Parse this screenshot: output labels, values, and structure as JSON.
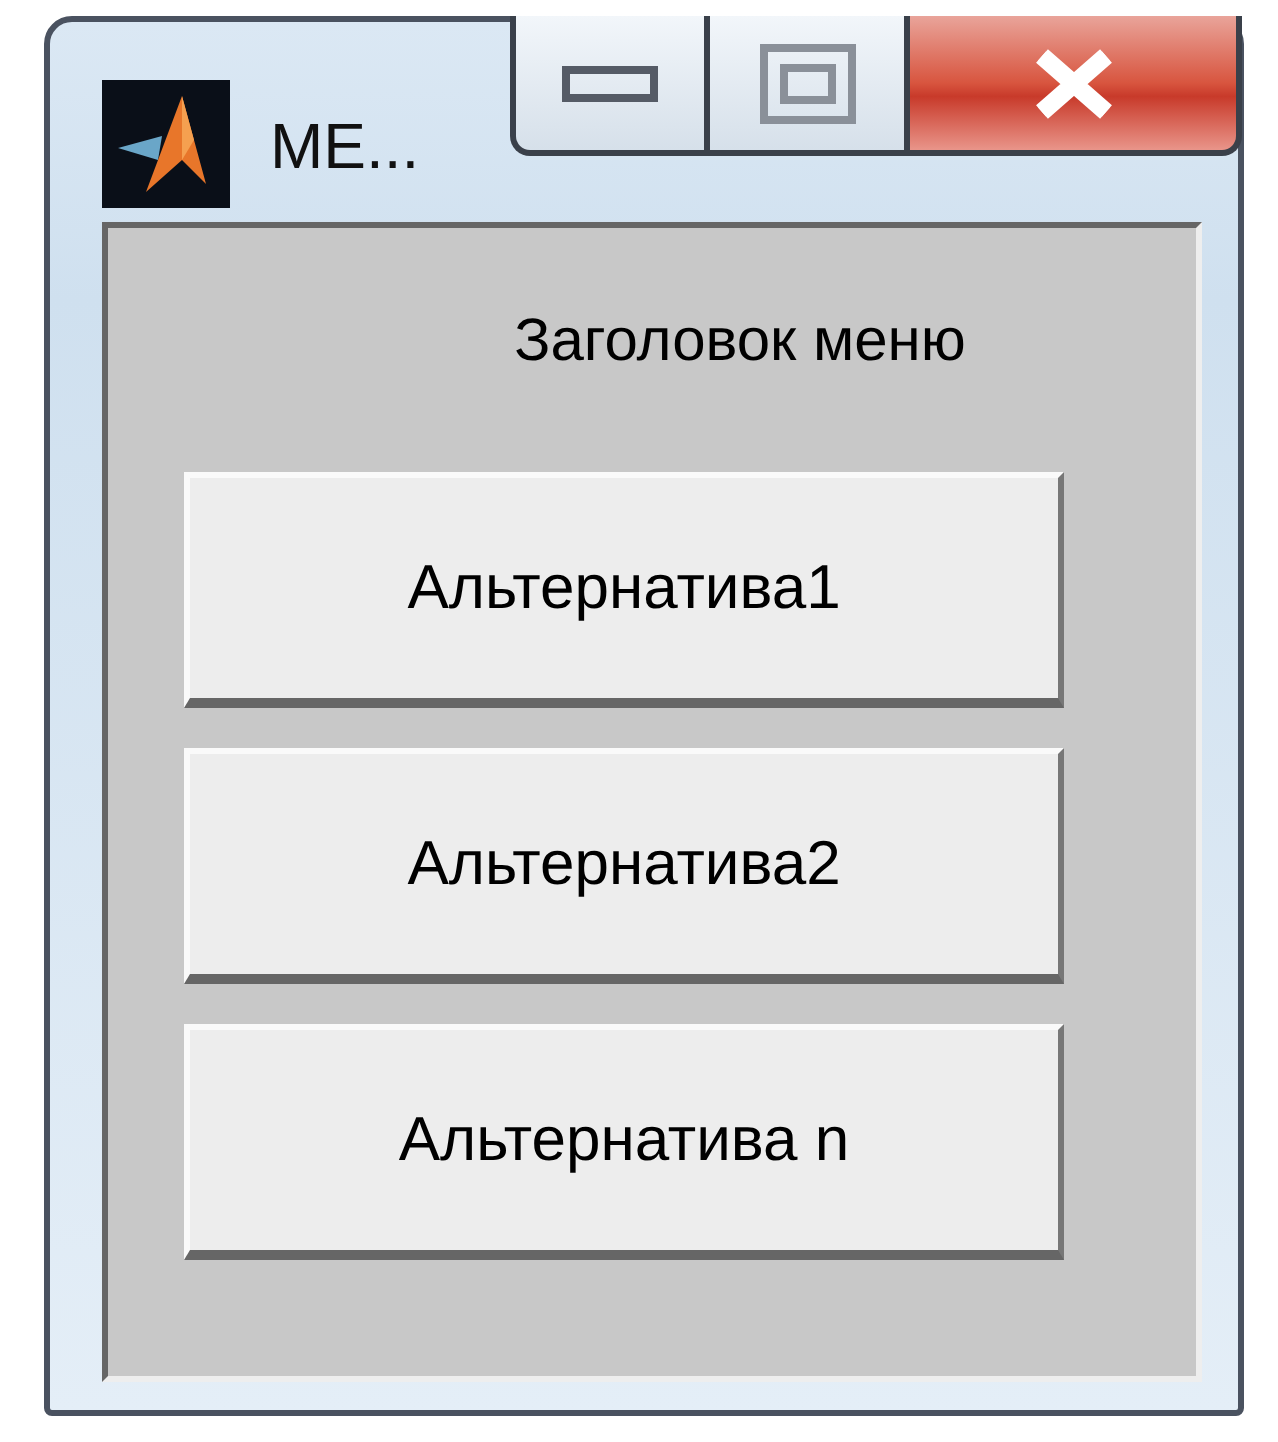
{
  "window": {
    "title": "ME..."
  },
  "menu": {
    "header": "Заголовок меню",
    "items": [
      "Альтернатива1",
      "Альтернатива2",
      "Альтернатива n"
    ]
  }
}
